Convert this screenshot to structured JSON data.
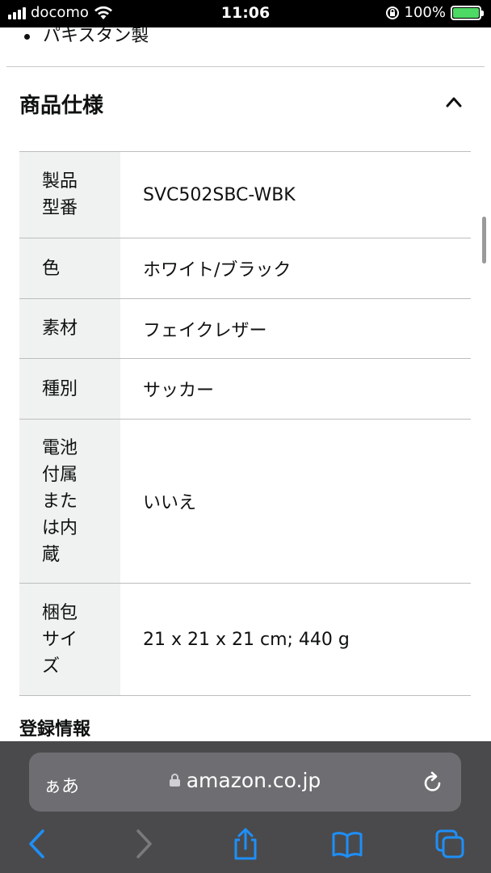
{
  "status_bar": {
    "carrier": "docomo",
    "time": "11:06",
    "battery_pct": "100%",
    "battery_level": 1.0,
    "icons": [
      "signal-icon",
      "wifi-icon",
      "orientation-lock-icon",
      "battery-charging-icon"
    ]
  },
  "page": {
    "cut_text": "パキスタン製",
    "section_title": "商品仕様",
    "section_expanded": true,
    "specs": [
      {
        "key": "製品\n型番",
        "value": "SVC502SBC-WBK"
      },
      {
        "key": "色",
        "value": "ホワイト/ブラック"
      },
      {
        "key": "素材",
        "value": "フェイクレザー"
      },
      {
        "key": "種別",
        "value": "サッカー"
      },
      {
        "key": "電池\n付属\nまた\nは内\n蔵",
        "value": "いいえ"
      },
      {
        "key": "梱包\nサイ\nズ",
        "value": "21 x 21 x 21 cm; 440 g"
      }
    ],
    "next_section": "登録情報"
  },
  "browser": {
    "aa_label": "ぁあ",
    "url": "amazon.co.jp",
    "icons": [
      "back-icon",
      "forward-icon",
      "share-icon",
      "bookmarks-icon",
      "tabs-icon",
      "lock-icon",
      "reload-icon"
    ],
    "colors": {
      "accent": "#1e8ff7",
      "disabled": "#7a7a7e"
    }
  }
}
